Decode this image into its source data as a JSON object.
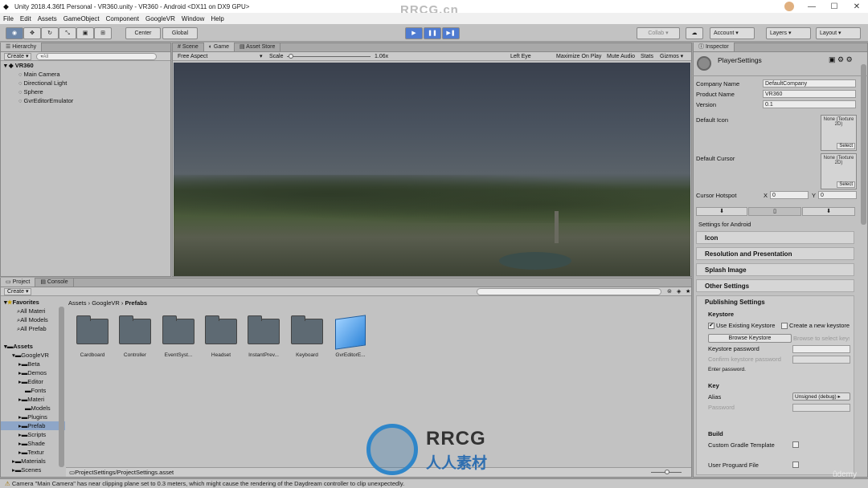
{
  "window": {
    "title": "Unity 2018.4.36f1 Personal - VR360.unity - VR360 - Android <DX11 on DX9 GPU>",
    "watermark_top": "RRCG.cn",
    "minimize": "—",
    "maximize": "☐",
    "close": "✕"
  },
  "menu": [
    "File",
    "Edit",
    "Assets",
    "GameObject",
    "Component",
    "GoogleVR",
    "Window",
    "Help"
  ],
  "toolbar": {
    "center": "Center",
    "global": "Global",
    "collab": "Collab ▾",
    "account": "Account",
    "layers": "Layers",
    "layout": "Layout",
    "play": "▶",
    "pause": "❚❚",
    "step": "▶❚"
  },
  "hierarchy": {
    "tab": "Hierarchy",
    "create": "Create ▾",
    "search_placeholder": "▾All",
    "scene": "VR360",
    "items": [
      "Main Camera",
      "Directional Light",
      "Sphere",
      "GvrEditorEmulator"
    ]
  },
  "game": {
    "tabs": [
      "Scene",
      "Game",
      "Asset Store"
    ],
    "aspect": "Free Aspect",
    "scale_label": "Scale",
    "scale_value": "1.06x",
    "eye": "Left Eye",
    "maximize": "Maximize On Play",
    "mute": "Mute Audio",
    "stats": "Stats",
    "gizmos": "Gizmos ▾"
  },
  "project": {
    "tabs": [
      "Project",
      "Console"
    ],
    "create": "Create ▾",
    "breadcrumb": [
      "Assets",
      "GoogleVR",
      "Prefabs"
    ],
    "favorites_label": "Favorites",
    "favorites": [
      "All Materi",
      "All Models",
      "All Prefab"
    ],
    "assets_label": "Assets",
    "tree": [
      "GoogleVR",
      "Beta",
      "Demos",
      "Editor",
      "Fonts",
      "Materi",
      "Models",
      "Plugins",
      "Prefab",
      "Scripts",
      "Shade",
      "Textur",
      "Materials",
      "Scenes"
    ],
    "items": [
      "Cardboard",
      "Controller",
      "EventSyst...",
      "Headset",
      "InstantPrev...",
      "Keyboard",
      "GvrEditorE..."
    ],
    "footer_path": "ProjectSettings/ProjectSettings.asset"
  },
  "inspector": {
    "tab": "Inspector",
    "title": "PlayerSettings",
    "company_label": "Company Name",
    "company": "DefaultCompany",
    "product_label": "Product Name",
    "product": "VR360",
    "version_label": "Version",
    "version": "0.1",
    "default_icon": "Default Icon",
    "default_cursor": "Default Cursor",
    "none_tex": "None (Texture 2D)",
    "select": "Select",
    "hotspot": "Cursor Hotspot",
    "hx_label": "X",
    "hx": "0",
    "hy_label": "Y",
    "hy": "0",
    "settings_for": "Settings for Android",
    "sections": [
      "Icon",
      "Resolution and Presentation",
      "Splash Image",
      "Other Settings"
    ],
    "publishing": "Publishing Settings",
    "keystore": "Keystore",
    "use_existing": "Use Existing Keystore",
    "create_new": "Create a new keystore",
    "browse": "Browse Keystore",
    "browse_hint": "Browse to select keystore",
    "ks_password": "Keystore password",
    "confirm_password": "Confirm keystore password",
    "enter_password": "Enter password.",
    "key": "Key",
    "alias_label": "Alias",
    "alias_value": "Unsigned (debug)",
    "password_label": "Password",
    "build": "Build",
    "custom_gradle": "Custom Gradle Template",
    "user_proguard": "User Proguard File"
  },
  "status": "Camera \"Main Camera\" has near clipping plane set to 0.3 meters, which might cause the rendering of the Daydream controller to clip unexpectedly.",
  "watermark": {
    "brand": "RRCG",
    "chinese": "人人素材",
    "udemy": "ûdemy"
  }
}
